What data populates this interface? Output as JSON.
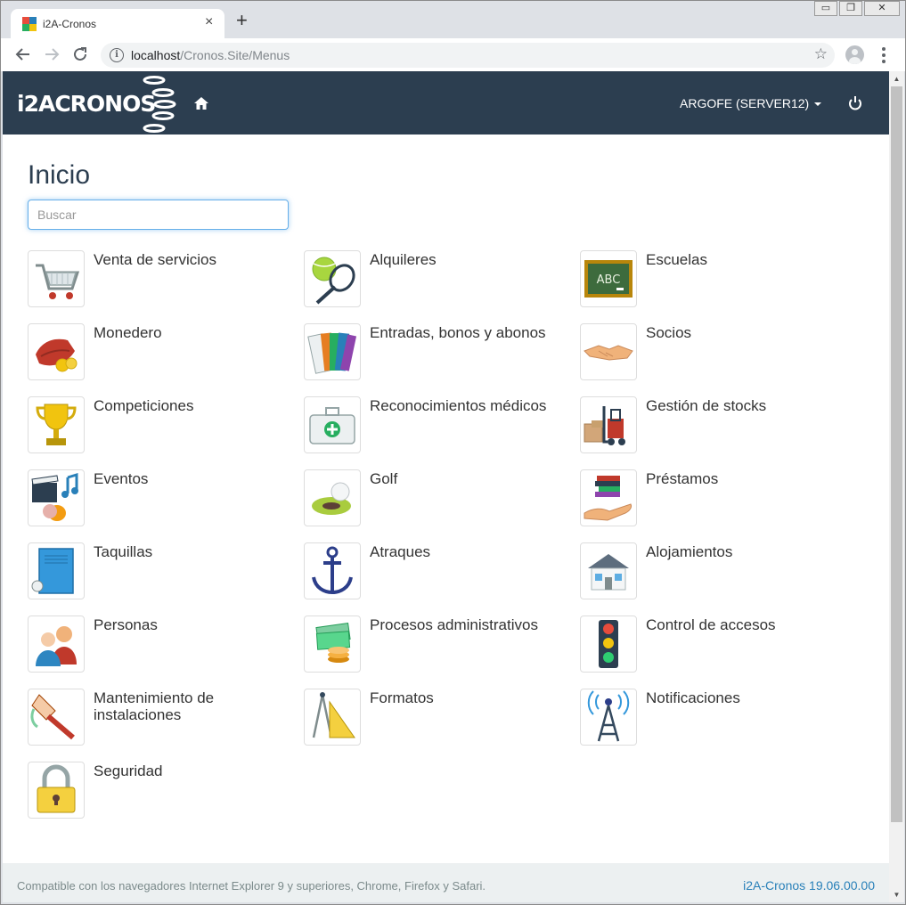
{
  "browser": {
    "tab_title": "i2A-Cronos",
    "url_host": "localhost",
    "url_path": "/Cronos.Site/Menus"
  },
  "navbar": {
    "logo_text": "i2ACRONOS",
    "user_label": "ARGOFE (SERVER12)"
  },
  "page": {
    "title": "Inicio",
    "search_placeholder": "Buscar"
  },
  "menu": [
    {
      "label": "Venta de servicios",
      "icon": "shopping-cart-icon"
    },
    {
      "label": "Alquileres",
      "icon": "tennis-icon"
    },
    {
      "label": "Escuelas",
      "icon": "chalkboard-icon"
    },
    {
      "label": "Monedero",
      "icon": "wallet-icon"
    },
    {
      "label": "Entradas, bonos y abonos",
      "icon": "tickets-icon"
    },
    {
      "label": "Socios",
      "icon": "handshake-icon"
    },
    {
      "label": "Competiciones",
      "icon": "trophy-icon"
    },
    {
      "label": "Reconocimientos médicos",
      "icon": "first-aid-icon"
    },
    {
      "label": "Gestión de stocks",
      "icon": "forklift-icon"
    },
    {
      "label": "Eventos",
      "icon": "clapperboard-icon"
    },
    {
      "label": "Golf",
      "icon": "golf-icon"
    },
    {
      "label": "Préstamos",
      "icon": "books-hand-icon"
    },
    {
      "label": "Taquillas",
      "icon": "locker-icon"
    },
    {
      "label": "Atraques",
      "icon": "anchor-icon"
    },
    {
      "label": "Alojamientos",
      "icon": "house-icon"
    },
    {
      "label": "Personas",
      "icon": "people-icon"
    },
    {
      "label": "Procesos administrativos",
      "icon": "money-icon"
    },
    {
      "label": "Control de accesos",
      "icon": "traffic-light-icon"
    },
    {
      "label": "Mantenimiento de instalaciones",
      "icon": "paintbrush-icon"
    },
    {
      "label": "Formatos",
      "icon": "ruler-compass-icon"
    },
    {
      "label": "Notificaciones",
      "icon": "antenna-icon"
    },
    {
      "label": "Seguridad",
      "icon": "padlock-icon"
    }
  ],
  "footer": {
    "compat_text": "Compatible con los navegadores Internet Explorer 9 y superiores, Chrome, Firefox y Safari.",
    "version": "i2A-Cronos 19.06.00.00"
  },
  "colors": {
    "navbar": "#2c3e50",
    "link": "#2980b9",
    "footer_bg": "#ecf0f1"
  }
}
